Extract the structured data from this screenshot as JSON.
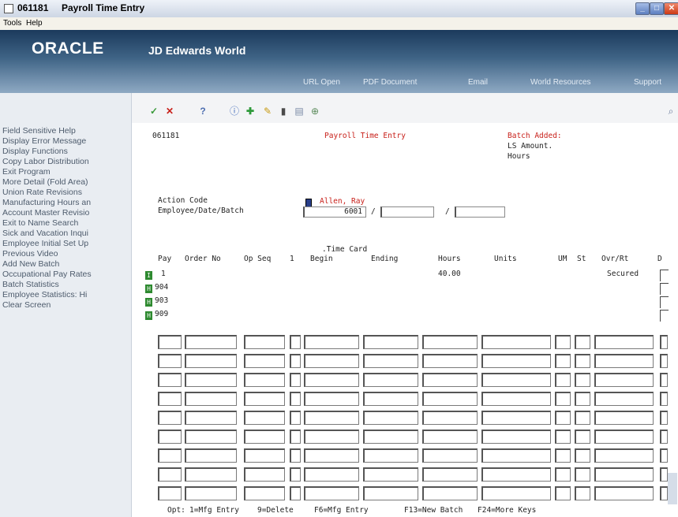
{
  "window": {
    "code": "061181",
    "title": "Payroll Time Entry",
    "minimize_icon": "minimize-icon",
    "maximize_icon": "maximize-icon",
    "close_icon": "close-icon"
  },
  "menu": {
    "tools": "Tools",
    "help": "Help"
  },
  "banner": {
    "logo": "ORACLE",
    "product": "JD Edwards World",
    "links": [
      "URL Open",
      "PDF Document",
      "Email",
      "World Resources",
      "Support"
    ]
  },
  "sidemenu": {
    "items": [
      "Field Sensitive Help",
      "Display Error Message",
      "Display Functions",
      "Copy Labor Distribution",
      "Exit Program",
      "More Detail (Fold Area)",
      "Union Rate Revisions",
      "Manufacturing Hours an",
      "Account Master Revisio",
      "Exit to Name Search",
      "Sick and Vacation Inqui",
      "Employee Initial Set Up",
      "Previous Video",
      "Add New Batch",
      "Occupational Pay Rates",
      "Batch Statistics",
      "Employee Statistics: Hi",
      "Clear Screen"
    ]
  },
  "toolbar": {
    "icons": [
      "check-icon",
      "cancel-icon",
      "help-icon",
      "info-icon",
      "add-icon",
      "edit-icon",
      "delete-icon",
      "print-icon",
      "zoom-icon"
    ],
    "help_glyph": "?",
    "cancel_glyph": "✕",
    "search_icon": "search-icon"
  },
  "screen": {
    "program_id": "061181",
    "title": "Payroll Time Entry",
    "batch_added_label": "Batch Added:",
    "ls_amount_label": "LS Amount.",
    "hours_label": "Hours",
    "action_code_label": "Action Code",
    "employee_name": "Allen, Ray",
    "employee_date_batch_label": "Employee/Date/Batch",
    "employee_number": "6001",
    "slash1": "/",
    "slash2": "/",
    "time_card_label": ".Time Card",
    "columns": {
      "pay": "Pay",
      "order_no": "Order No",
      "op_seq": "Op Seq",
      "one": "1",
      "begin": "Begin",
      "ending": "Ending",
      "hours": "Hours",
      "units": "Units",
      "um": "UM",
      "st": "St",
      "ovr_rt": "Ovr/Rt",
      "d": "D"
    },
    "rows": [
      {
        "opt": "I",
        "pay": "1",
        "hours": "40.00",
        "ovr_rt": "Secured"
      },
      {
        "opt": "H",
        "pay": "904",
        "hours": "",
        "ovr_rt": ""
      },
      {
        "opt": "H",
        "pay": "903",
        "hours": "",
        "ovr_rt": ""
      },
      {
        "opt": "H",
        "pay": "909",
        "hours": "",
        "ovr_rt": ""
      }
    ],
    "footer": {
      "opt": "Opt:",
      "keys": [
        "1=Mfg Entry",
        "9=Delete",
        "F6=Mfg Entry",
        "F13=New Batch",
        "F24=More Keys"
      ]
    }
  }
}
